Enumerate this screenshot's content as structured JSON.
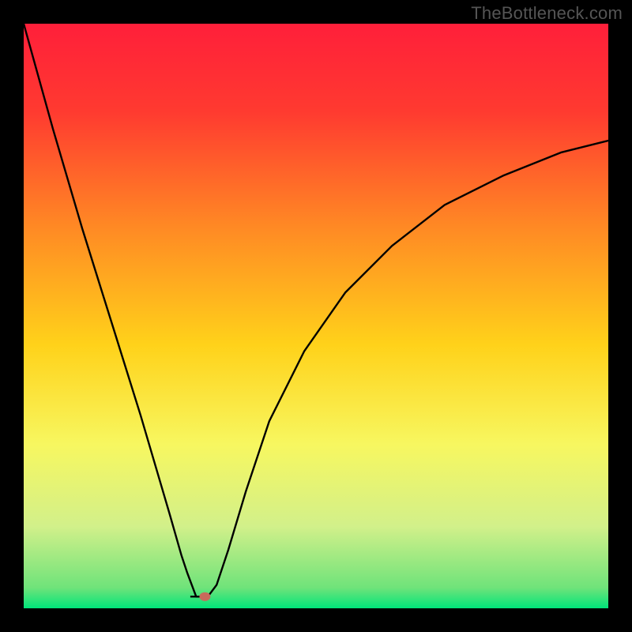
{
  "watermark": "TheBottleneck.com",
  "chart_data": {
    "type": "line",
    "title": "",
    "xlabel": "",
    "ylabel": "",
    "xlim": [
      0,
      100
    ],
    "ylim": [
      0,
      100
    ],
    "background_gradient_stops": [
      {
        "offset": 0.0,
        "color": "#ff1f3a"
      },
      {
        "offset": 0.15,
        "color": "#ff3a30"
      },
      {
        "offset": 0.35,
        "color": "#ff8a24"
      },
      {
        "offset": 0.55,
        "color": "#ffd21a"
      },
      {
        "offset": 0.72,
        "color": "#f7f760"
      },
      {
        "offset": 0.86,
        "color": "#d2f08a"
      },
      {
        "offset": 0.965,
        "color": "#6fe37a"
      },
      {
        "offset": 1.0,
        "color": "#00e47a"
      }
    ],
    "curve": {
      "x": [
        0,
        5,
        10,
        15,
        20,
        25,
        27,
        28,
        29.5,
        30,
        31.5,
        33,
        35,
        38,
        42,
        48,
        55,
        63,
        72,
        82,
        92,
        100
      ],
      "y": [
        100,
        82,
        65,
        49,
        33,
        16,
        9,
        6,
        2,
        2,
        2,
        4,
        10,
        20,
        32,
        44,
        54,
        62,
        69,
        74,
        78,
        80
      ]
    },
    "flat_segment": {
      "x0": 28.5,
      "x1": 31.5,
      "y": 2
    },
    "marker": {
      "x": 31,
      "y": 2,
      "color": "#c96a5b"
    }
  }
}
